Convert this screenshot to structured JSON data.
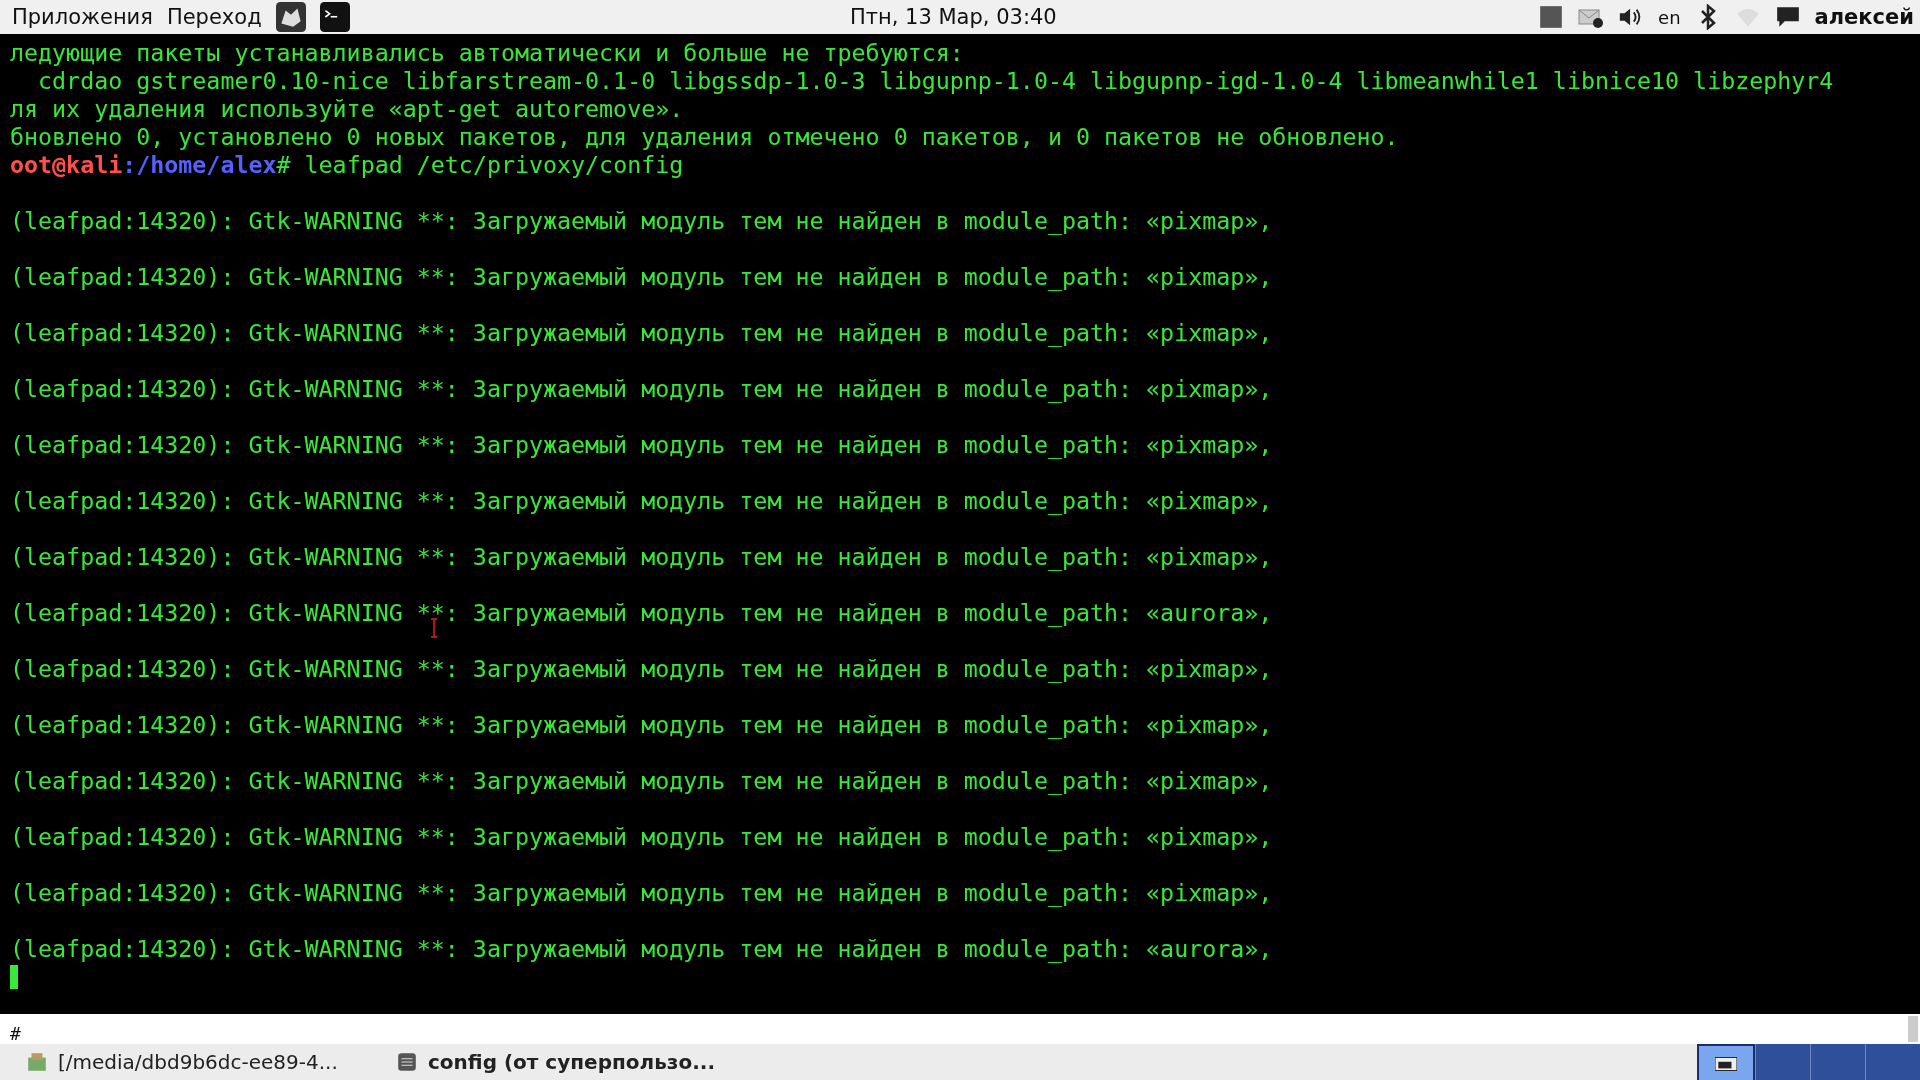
{
  "top_panel": {
    "menus": [
      "Приложения",
      "Переход"
    ],
    "clock": "Птн, 13 Мар, 03:40",
    "keyboard_layout": "en",
    "user": "алексей"
  },
  "terminal": {
    "lines": [
      {
        "kind": "text",
        "text": "ледующие пакеты устанавливались автоматически и больше не требуются:"
      },
      {
        "kind": "text",
        "text": "  cdrdao gstreamer0.10-nice libfarstream-0.1-0 libgssdp-1.0-3 libgupnp-1.0-4 libgupnp-igd-1.0-4 libmeanwhile1 libnice10 libzephyr4"
      },
      {
        "kind": "text",
        "text": "ля их удаления используйте «apt-get autoremove»."
      },
      {
        "kind": "text",
        "text": "бновлено 0, установлено 0 новых пакетов, для удаления отмечено 0 пакетов, и 0 пакетов не обновлено."
      },
      {
        "kind": "prompt",
        "user": "oot@kali",
        "path": ":/home/alex",
        "command": "# leafpad /etc/privoxy/config"
      },
      {
        "kind": "blank"
      },
      {
        "kind": "text",
        "text": "(leafpad:14320): Gtk-WARNING **: Загружаемый модуль тем не найден в module_path: «pixmap»,"
      },
      {
        "kind": "blank"
      },
      {
        "kind": "text",
        "text": "(leafpad:14320): Gtk-WARNING **: Загружаемый модуль тем не найден в module_path: «pixmap»,"
      },
      {
        "kind": "blank"
      },
      {
        "kind": "text",
        "text": "(leafpad:14320): Gtk-WARNING **: Загружаемый модуль тем не найден в module_path: «pixmap»,"
      },
      {
        "kind": "blank"
      },
      {
        "kind": "text",
        "text": "(leafpad:14320): Gtk-WARNING **: Загружаемый модуль тем не найден в module_path: «pixmap»,"
      },
      {
        "kind": "blank"
      },
      {
        "kind": "text",
        "text": "(leafpad:14320): Gtk-WARNING **: Загружаемый модуль тем не найден в module_path: «pixmap»,"
      },
      {
        "kind": "blank"
      },
      {
        "kind": "text",
        "text": "(leafpad:14320): Gtk-WARNING **: Загружаемый модуль тем не найден в module_path: «pixmap»,"
      },
      {
        "kind": "blank"
      },
      {
        "kind": "text",
        "text": "(leafpad:14320): Gtk-WARNING **: Загружаемый модуль тем не найден в module_path: «pixmap»,"
      },
      {
        "kind": "blank"
      },
      {
        "kind": "text",
        "text": "(leafpad:14320): Gtk-WARNING **: Загружаемый модуль тем не найден в module_path: «aurora»,"
      },
      {
        "kind": "blank"
      },
      {
        "kind": "text",
        "text": "(leafpad:14320): Gtk-WARNING **: Загружаемый модуль тем не найден в module_path: «pixmap»,"
      },
      {
        "kind": "blank"
      },
      {
        "kind": "text",
        "text": "(leafpad:14320): Gtk-WARNING **: Загружаемый модуль тем не найден в module_path: «pixmap»,"
      },
      {
        "kind": "blank"
      },
      {
        "kind": "text",
        "text": "(leafpad:14320): Gtk-WARNING **: Загружаемый модуль тем не найден в module_path: «pixmap»,"
      },
      {
        "kind": "blank"
      },
      {
        "kind": "text",
        "text": "(leafpad:14320): Gtk-WARNING **: Загружаемый модуль тем не найден в module_path: «pixmap»,"
      },
      {
        "kind": "blank"
      },
      {
        "kind": "text",
        "text": "(leafpad:14320): Gtk-WARNING **: Загружаемый модуль тем не найден в module_path: «pixmap»,"
      },
      {
        "kind": "blank"
      },
      {
        "kind": "text",
        "text": "(leafpad:14320): Gtk-WARNING **: Загружаемый модуль тем не найден в module_path: «aurora»,"
      },
      {
        "kind": "cursor"
      }
    ]
  },
  "editor_behind": {
    "line": "#"
  },
  "taskbar": {
    "tasks": [
      {
        "label": "[/media/dbd9b6dc-ee89-4...",
        "selected": false
      },
      {
        "label": "config (от суперпользо...",
        "selected": false
      }
    ],
    "workspaces": [
      {
        "selected": true
      },
      {
        "selected": false
      },
      {
        "selected": false
      },
      {
        "selected": false
      }
    ]
  }
}
